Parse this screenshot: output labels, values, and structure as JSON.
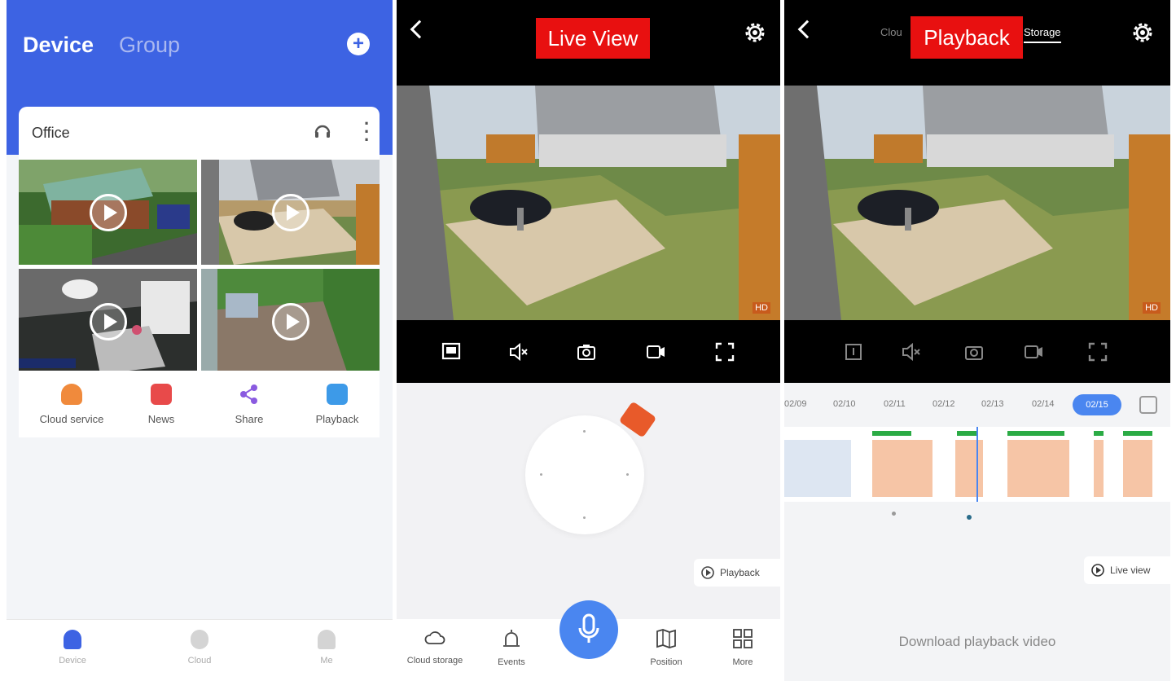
{
  "device_list": {
    "tabs": {
      "active": "Device",
      "inactive": "Group"
    },
    "add_icon": "plus-circle-icon",
    "card": {
      "name": "Office"
    },
    "quick_actions": [
      {
        "label": "Cloud service",
        "icon": "cloud-upload-icon",
        "color": "#f08a3c"
      },
      {
        "label": "News",
        "icon": "megaphone-icon",
        "color": "#e84a4a"
      },
      {
        "label": "Share",
        "icon": "share-icon",
        "color": "#8a5ae0"
      },
      {
        "label": "Playback",
        "icon": "playback-icon",
        "color": "#3d9ae8"
      }
    ],
    "bottom_nav": [
      {
        "label": "Device",
        "icon": "device-icon",
        "active": true
      },
      {
        "label": "Cloud",
        "icon": "cloud-icon",
        "active": false
      },
      {
        "label": "Me",
        "icon": "user-icon",
        "active": false
      }
    ]
  },
  "live_view": {
    "title_label": "Live View",
    "hd_badge": "HD",
    "controls": [
      "multi-screen-icon",
      "mute-icon",
      "snapshot-icon",
      "record-icon",
      "fullscreen-icon"
    ],
    "playback_button": "Playback",
    "bottom_nav": [
      {
        "label": "Cloud storage",
        "icon": "cloud-icon"
      },
      {
        "label": "Events",
        "icon": "alarm-icon"
      },
      {
        "label": "Position",
        "icon": "map-icon"
      },
      {
        "label": "More",
        "icon": "grid-icon"
      }
    ],
    "mic_icon": "microphone-icon"
  },
  "playback": {
    "title_label": "Playback",
    "tab_cloud": "Clou",
    "tab_storage": "Storage",
    "hd_badge": "HD",
    "dates": [
      "02/09",
      "02/10",
      "02/11",
      "02/12",
      "02/13",
      "02/14"
    ],
    "active_date": "02/15",
    "live_view_button": "Live view",
    "download_text": "Download playback video",
    "accent_color": "#4a86f0"
  }
}
